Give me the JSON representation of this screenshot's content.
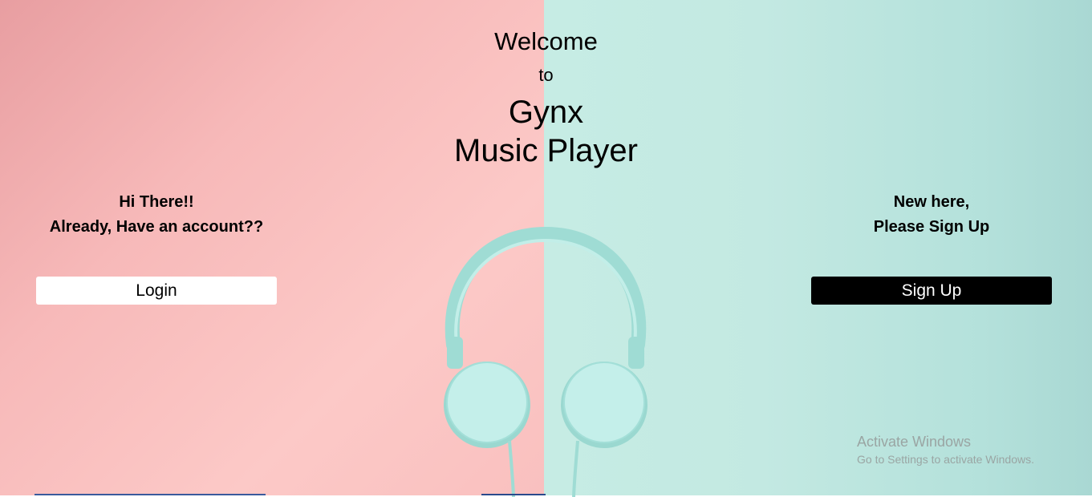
{
  "welcome": {
    "line1": "Welcome",
    "line2": "to",
    "line3": "Gynx",
    "line4": "Music Player"
  },
  "login_panel": {
    "line1": "Hi There!!",
    "line2": "Already, Have an account??",
    "button_label": "Login"
  },
  "signup_panel": {
    "line1": "New here,",
    "line2": "Please Sign Up",
    "button_label": "Sign Up"
  },
  "os_overlay": {
    "title": "Activate Windows",
    "subtitle": "Go to Settings to activate Windows."
  },
  "colors": {
    "left_background": "#f7b9b9",
    "right_background": "#c3e9e2",
    "headphones": "#a9e3dc",
    "login_button": "#ffffff",
    "signup_button": "#000000"
  }
}
